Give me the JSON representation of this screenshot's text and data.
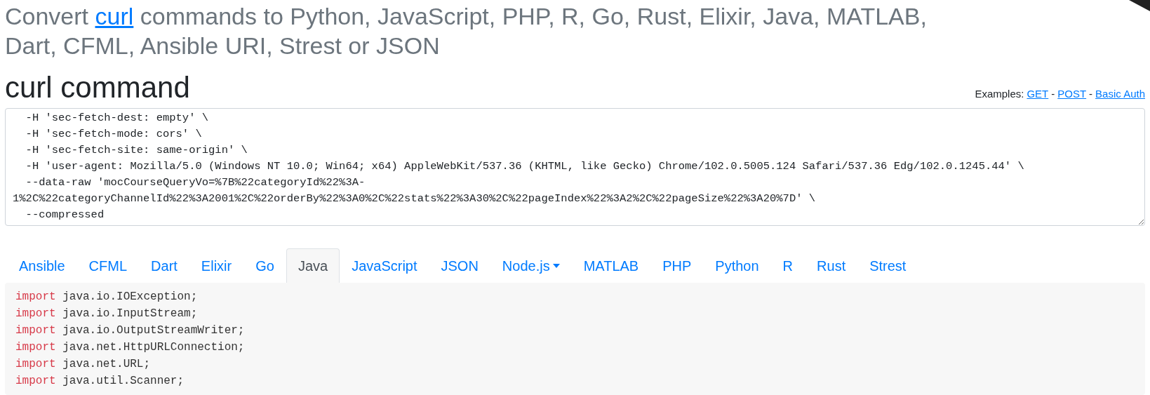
{
  "header": {
    "title_before": "Convert ",
    "title_link": "curl",
    "title_after": " commands to Python, JavaScript, PHP, R, Go, Rust, Elixir, Java, MATLAB, Dart, CFML, Ansible URI, Strest or JSON"
  },
  "curl_section": {
    "heading": "curl command",
    "examples_label": "Examples:",
    "examples": [
      "GET",
      "POST",
      "Basic Auth"
    ],
    "separator": "-",
    "command": "  -H 'sec-fetch-dest: empty' \\\n  -H 'sec-fetch-mode: cors' \\\n  -H 'sec-fetch-site: same-origin' \\\n  -H 'user-agent: Mozilla/5.0 (Windows NT 10.0; Win64; x64) AppleWebKit/537.36 (KHTML, like Gecko) Chrome/102.0.5005.124 Safari/537.36 Edg/102.0.1245.44' \\\n  --data-raw 'mocCourseQueryVo=%7B%22categoryId%22%3A-1%2C%22categoryChannelId%22%3A2001%2C%22orderBy%22%3A0%2C%22stats%22%3A30%2C%22pageIndex%22%3A2%2C%22pageSize%22%3A20%7D' \\\n  --compressed"
  },
  "tabs": [
    {
      "label": "Ansible",
      "kind": "tab",
      "selected": false
    },
    {
      "label": "CFML",
      "kind": "tab",
      "selected": false
    },
    {
      "label": "Dart",
      "kind": "tab",
      "selected": false
    },
    {
      "label": "Elixir",
      "kind": "tab",
      "selected": false
    },
    {
      "label": "Go",
      "kind": "tab",
      "selected": false
    },
    {
      "label": "Java",
      "kind": "tab",
      "selected": true
    },
    {
      "label": "JavaScript",
      "kind": "tab",
      "selected": false
    },
    {
      "label": "JSON",
      "kind": "tab",
      "selected": false
    },
    {
      "label": "Node.js",
      "kind": "dropdown",
      "selected": false
    },
    {
      "label": "MATLAB",
      "kind": "tab",
      "selected": false
    },
    {
      "label": "PHP",
      "kind": "tab",
      "selected": false
    },
    {
      "label": "Python",
      "kind": "tab",
      "selected": false
    },
    {
      "label": "R",
      "kind": "tab",
      "selected": false
    },
    {
      "label": "Rust",
      "kind": "tab",
      "selected": false
    },
    {
      "label": "Strest",
      "kind": "tab",
      "selected": false
    }
  ],
  "code": [
    {
      "keyword": "import",
      "rest": " java.io.IOException;"
    },
    {
      "keyword": "import",
      "rest": " java.io.InputStream;"
    },
    {
      "keyword": "import",
      "rest": " java.io.OutputStreamWriter;"
    },
    {
      "keyword": "import",
      "rest": " java.net.HttpURLConnection;"
    },
    {
      "keyword": "import",
      "rest": " java.net.URL;"
    },
    {
      "keyword": "import",
      "rest": " java.util.Scanner;"
    }
  ]
}
